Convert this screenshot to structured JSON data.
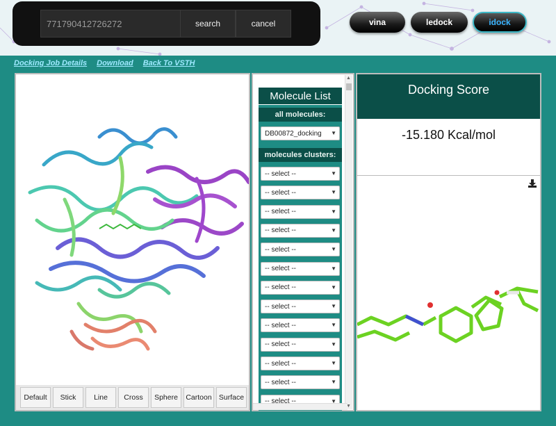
{
  "search": {
    "value": "771790412726272",
    "search_label": "search",
    "cancel_label": "cancel"
  },
  "tools": [
    {
      "label": "vina",
      "active": false
    },
    {
      "label": "ledock",
      "active": false
    },
    {
      "label": "idock",
      "active": true
    }
  ],
  "links": [
    "Docking Job Details",
    "Download",
    "Back To VSTH"
  ],
  "viewer_styles": [
    "Default",
    "Stick",
    "Line",
    "Cross",
    "Sphere",
    "Cartoon",
    "Surface"
  ],
  "molecule_list": {
    "title": "Molecule List",
    "all_label": "all molecules:",
    "selected_molecule": "DB00872_docking",
    "clusters_label": "molecules clusters:",
    "cluster_placeholder": "-- select --",
    "cluster_count": 15
  },
  "docking": {
    "title": "Docking Score",
    "score": "-15.180 Kcal/mol"
  },
  "icons": {
    "download": "download-icon",
    "scroll_up": "scroll-up-icon",
    "scroll_down": "scroll-down-icon",
    "chevron": "chevron-down-icon"
  },
  "colors": {
    "page_bg": "#1e8c84",
    "panel_dark": "#0b4f48",
    "active_tool": "#3ab4ff",
    "ligand": "#6cd222"
  }
}
